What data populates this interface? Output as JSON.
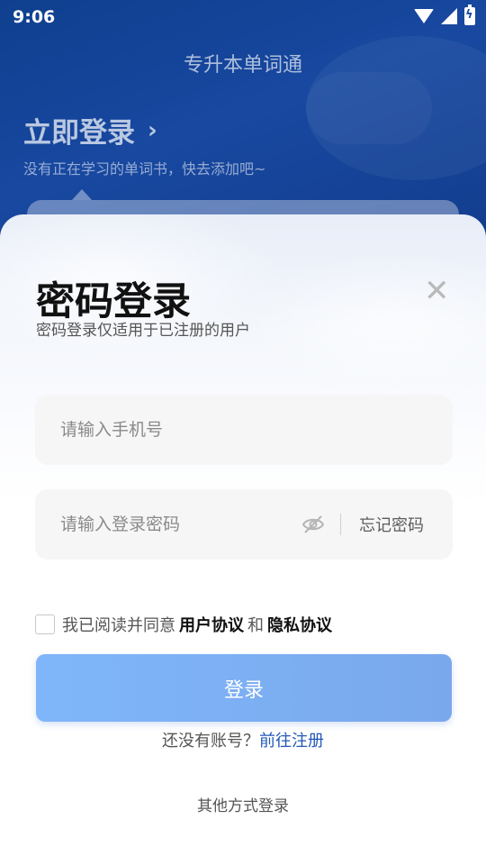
{
  "status_bar": {
    "time": "9:06"
  },
  "header": {
    "app_title": "专升本单词通",
    "login_link": "立即登录",
    "login_hint": "没有正在学习的单词书，快去添加吧~"
  },
  "login_sheet": {
    "title": "密码登录",
    "subtitle": "密码登录仅适用于已注册的用户",
    "phone_placeholder": "请输入手机号",
    "password_placeholder": "请输入登录密码",
    "forgot_password": "忘记密码",
    "agreement": {
      "prefix": "我已阅读并同意",
      "user_agreement": "用户协议",
      "and": "和",
      "privacy_policy": "隐私协议"
    },
    "login_button": "登录",
    "register_prompt": "还没有账号？",
    "register_link": "前往注册",
    "other_login": "其他方式登录"
  },
  "colors": {
    "header_bg": "#1848a0",
    "button_bg": "#7fb6fa",
    "link_blue": "#2358b8"
  }
}
